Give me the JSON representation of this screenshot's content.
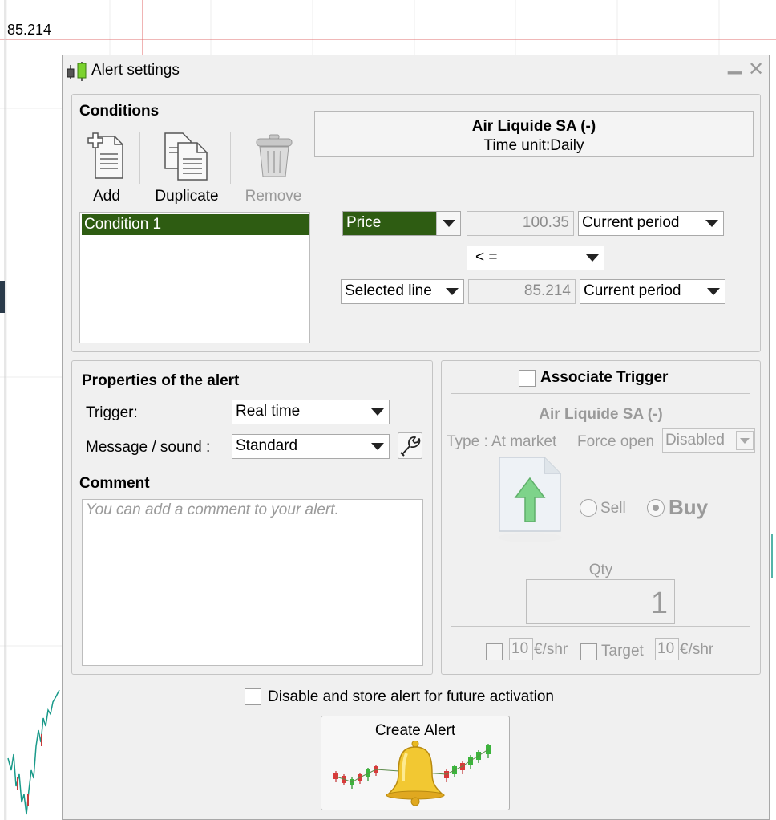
{
  "chart": {
    "price_label": "85.214"
  },
  "dialog": {
    "title": "Alert settings",
    "conditions": {
      "title": "Conditions",
      "add_label": "Add",
      "duplicate_label": "Duplicate",
      "remove_label": "Remove",
      "items": [
        "Condition 1"
      ],
      "instrument": "Air Liquide SA (-)",
      "time_unit_label": "Time unit:",
      "time_unit_value": "Daily",
      "row1": {
        "source": "Price",
        "value": "100.35",
        "period": "Current period"
      },
      "operator": "< =",
      "row2": {
        "source": "Selected line",
        "value": "85.214",
        "period": "Current period"
      }
    },
    "properties": {
      "title": "Properties of the alert",
      "trigger_label": "Trigger:",
      "trigger_value": "Real time",
      "message_label": "Message / sound :",
      "message_value": "Standard",
      "comment_title": "Comment",
      "comment_placeholder": "You can add a comment to your alert."
    },
    "trigger": {
      "title": "Associate Trigger",
      "instrument": "Air Liquide SA (-)",
      "type_label": "Type : At market",
      "force_open_label": "Force open",
      "force_open_value": "Disabled",
      "sell_label": "Sell",
      "buy_label": "Buy",
      "qty_label": "Qty",
      "qty_value": "1",
      "stop_value": "10",
      "stop_unit": "€/shr",
      "target_label": "Target",
      "target_value": "10",
      "target_unit": "€/shr"
    },
    "disable_label": "Disable and store alert for future activation",
    "create_label": "Create Alert"
  }
}
